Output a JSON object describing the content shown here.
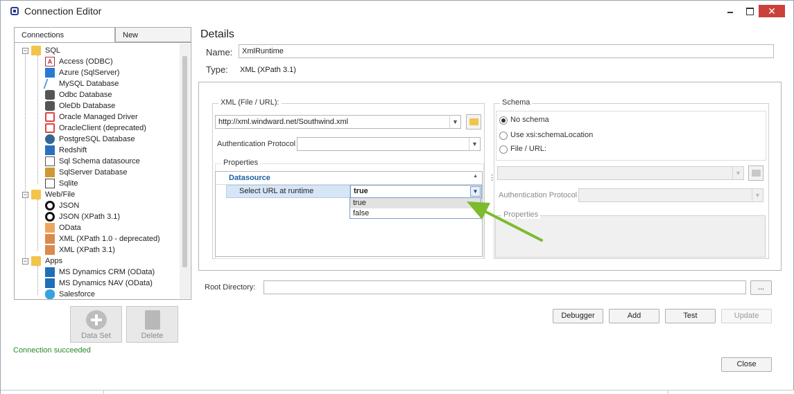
{
  "window": {
    "title": "Connection Editor",
    "close_glyph": "✕"
  },
  "left": {
    "tabs": [
      {
        "label": "Connections"
      },
      {
        "label": "New"
      }
    ],
    "tree": [
      {
        "label": "SQL",
        "icon": "folder-icon"
      },
      {
        "label": "Access (ODBC)",
        "icon": "access-icon"
      },
      {
        "label": "Azure (SqlServer)",
        "icon": "azure-icon"
      },
      {
        "label": "MySQL Database",
        "icon": "mysql-icon"
      },
      {
        "label": "Odbc Database",
        "icon": "database-icon"
      },
      {
        "label": "OleDb Database",
        "icon": "database-icon"
      },
      {
        "label": "Oracle Managed Driver",
        "icon": "oracle-icon"
      },
      {
        "label": "OracleClient (deprecated)",
        "icon": "oracle-icon"
      },
      {
        "label": "PostgreSQL Database",
        "icon": "postgresql-icon"
      },
      {
        "label": "Redshift",
        "icon": "redshift-icon"
      },
      {
        "label": "Sql Schema datasource",
        "icon": "schema-tree-icon"
      },
      {
        "label": "SqlServer Database",
        "icon": "sqlserver-icon"
      },
      {
        "label": "Sqlite",
        "icon": "sqlite-icon"
      },
      {
        "label": "Web/File",
        "icon": "folder-icon"
      },
      {
        "label": "JSON",
        "icon": "json-icon"
      },
      {
        "label": "JSON (XPath 3.1)",
        "icon": "json-icon"
      },
      {
        "label": "OData",
        "icon": "odata-icon"
      },
      {
        "label": "XML (XPath 1.0 - deprecated)",
        "icon": "xml-icon"
      },
      {
        "label": "XML (XPath 3.1)",
        "icon": "xml-icon"
      },
      {
        "label": "Apps",
        "icon": "folder-icon"
      },
      {
        "label": "MS Dynamics CRM (OData)",
        "icon": "dynamics-icon"
      },
      {
        "label": "MS Dynamics NAV (OData)",
        "icon": "dynamics-icon"
      },
      {
        "label": "Salesforce",
        "icon": "salesforce-icon"
      }
    ],
    "dataset_button": "Data Set",
    "delete_button": "Delete",
    "status": "Connection succeeded"
  },
  "details": {
    "heading": "Details",
    "name_label": "Name:",
    "name_value": "XmlRuntime",
    "type_label": "Type:",
    "type_value": "XML (XPath 3.1)",
    "xml_group_title": "XML (File / URL):",
    "xml_url": "http://xml.windward.net/Southwind.xml",
    "auth_label": "Authentication Protocol",
    "auth_value": "",
    "properties_title": "Properties",
    "grid": {
      "category": "Datasource",
      "row_key": "Select URL at runtime",
      "row_value": "true",
      "dropdown_options": [
        "true",
        "false"
      ]
    },
    "schema": {
      "title": "Schema",
      "options": [
        "No schema",
        "Use xsi:schemaLocation",
        "File / URL:"
      ],
      "selected": "No schema",
      "auth_label": "Authentication Protocol",
      "properties_title": "Properties"
    },
    "root_label": "Root Directory:",
    "root_value": "",
    "browse_label": "...",
    "buttons": {
      "debugger": "Debugger",
      "add": "Add",
      "test": "Test",
      "update": "Update",
      "close": "Close"
    }
  },
  "colors": {
    "status_green": "#2a8a2a",
    "arrow_green": "#7dbb2e",
    "category_blue": "#1f5fa6",
    "close_red": "#c9413a"
  }
}
